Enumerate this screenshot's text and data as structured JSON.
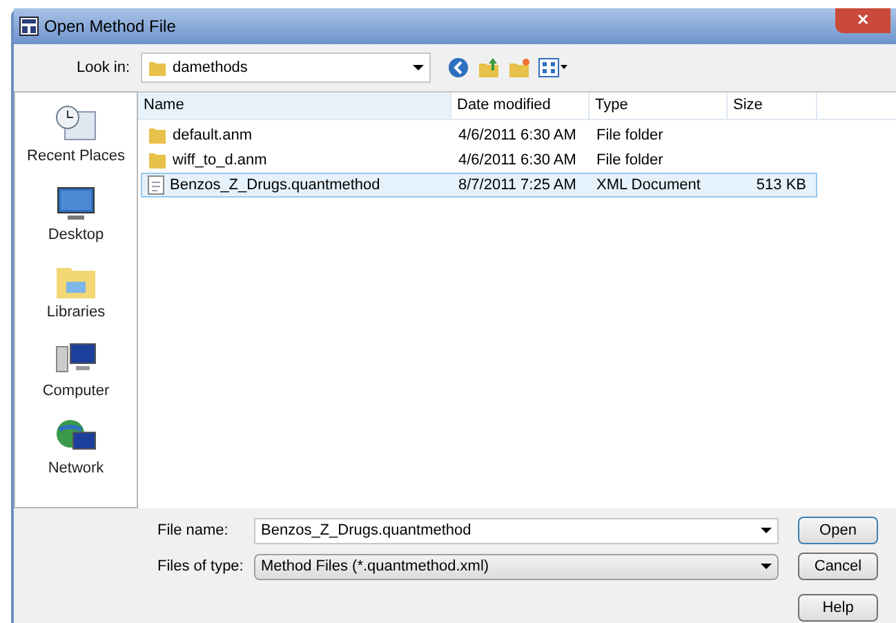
{
  "window": {
    "title": "Open Method File",
    "close": "✕"
  },
  "look_in": {
    "label": "Look in:",
    "value": "damethods"
  },
  "places": [
    {
      "label": "Recent Places",
      "kind": "recent"
    },
    {
      "label": "Desktop",
      "kind": "desktop"
    },
    {
      "label": "Libraries",
      "kind": "libraries"
    },
    {
      "label": "Computer",
      "kind": "computer"
    },
    {
      "label": "Network",
      "kind": "network"
    }
  ],
  "table": {
    "columns": [
      "Name",
      "Date modified",
      "Type",
      "Size"
    ],
    "rows": [
      {
        "name": "default.anm",
        "date": "4/6/2011 6:30 AM",
        "type": "File folder",
        "size": "",
        "kind": "folder",
        "selected": false
      },
      {
        "name": "wiff_to_d.anm",
        "date": "4/6/2011 6:30 AM",
        "type": "File folder",
        "size": "",
        "kind": "folder",
        "selected": false
      },
      {
        "name": "Benzos_Z_Drugs.quantmethod",
        "date": "8/7/2011 7:25 AM",
        "type": "XML Document",
        "size": "513 KB",
        "kind": "file",
        "selected": true
      }
    ]
  },
  "file_name": {
    "label": "File name:",
    "value": "Benzos_Z_Drugs.quantmethod"
  },
  "file_type": {
    "label": "Files of type:",
    "value": "Method Files (*.quantmethod.xml)"
  },
  "buttons": [
    "Open",
    "Cancel",
    "Help"
  ]
}
